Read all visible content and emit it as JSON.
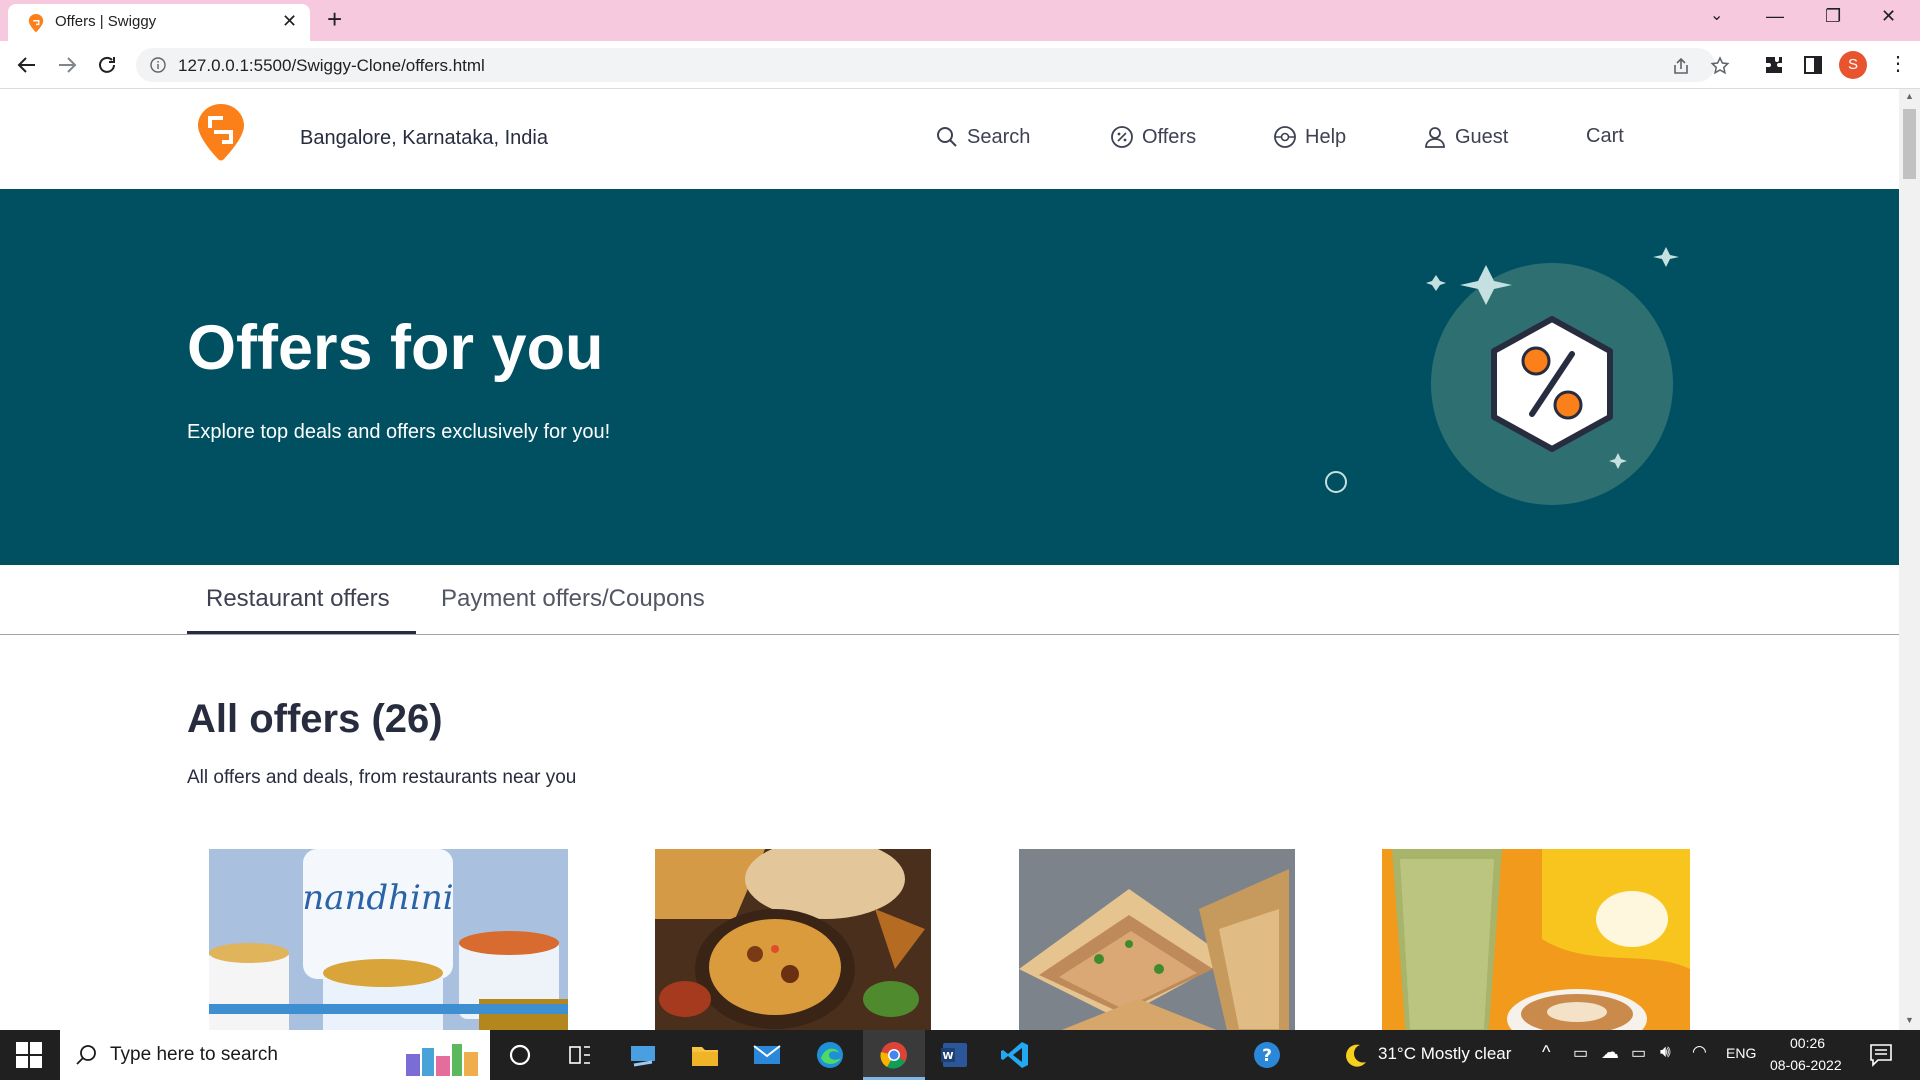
{
  "browser": {
    "tab_title": "Offers | Swiggy",
    "url": "127.0.0.1:5500/Swiggy-Clone/offers.html",
    "profile_initial": "S"
  },
  "header": {
    "location": "Bangalore, Karnataka, India",
    "menu": {
      "search": "Search",
      "offers": "Offers",
      "help": "Help",
      "guest": "Guest",
      "cart": "Cart"
    }
  },
  "hero": {
    "title": "Offers for you",
    "subtitle": "Explore top deals and offers exclusively for you!"
  },
  "tabs": [
    "Restaurant offers",
    "Payment offers/Coupons"
  ],
  "section": {
    "title": "All offers (26)",
    "subtitle": "All offers and deals, from restaurants near you"
  },
  "cards": [
    {
      "brand_text": "nandhini"
    },
    {
      "brand_text": ""
    },
    {
      "brand_text": ""
    },
    {
      "brand_text": ""
    }
  ],
  "taskbar": {
    "search_placeholder": "Type here to search",
    "weather": "31°C  Mostly clear",
    "language": "ENG",
    "time": "00:26",
    "date": "08-06-2022"
  },
  "colors": {
    "brand_orange": "#fc8019",
    "hero_bg": "#005062",
    "hero_circle": "#2e7071"
  }
}
